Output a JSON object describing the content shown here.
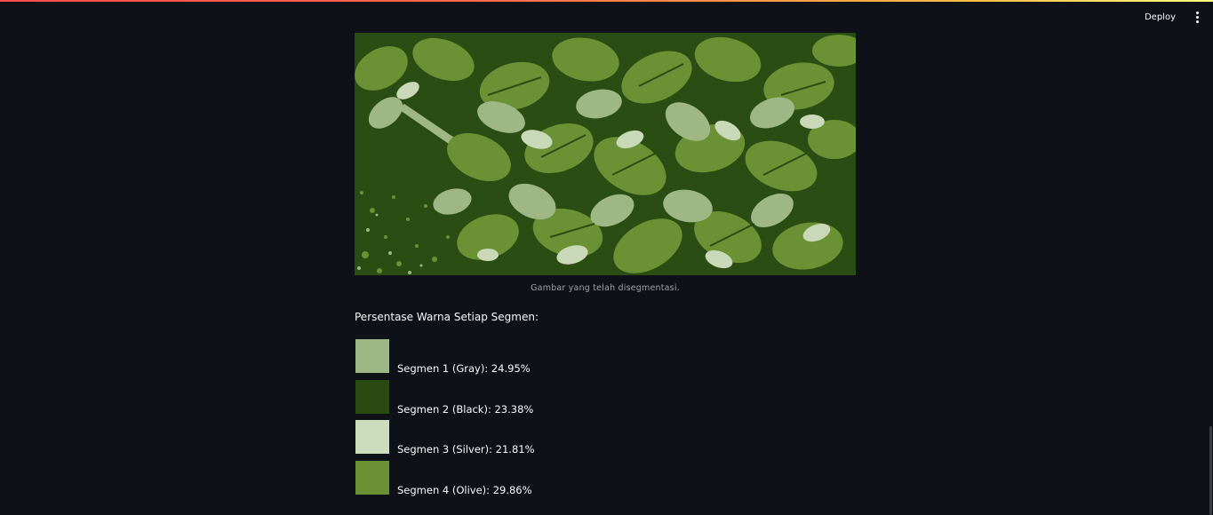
{
  "header": {
    "deploy_label": "Deploy",
    "menu_icon": "kebab-menu-icon"
  },
  "image": {
    "caption": "Gambar yang telah disegmentasi.",
    "palette": {
      "background": "#2a4d14",
      "olive": "#6a9234",
      "gray": "#9db785",
      "silver": "#c9d8b6"
    }
  },
  "segments": {
    "title": "Persentase Warna Setiap Segmen:",
    "items": [
      {
        "label": "Segmen 1 (Gray): 24.95%",
        "color": "#9db785"
      },
      {
        "label": "Segmen 2 (Black): 23.38%",
        "color": "#2a4a12"
      },
      {
        "label": "Segmen 3 (Silver): 21.81%",
        "color": "#cddcbc"
      },
      {
        "label": "Segmen 4 (Olive): 29.86%",
        "color": "#6a9234"
      }
    ]
  }
}
